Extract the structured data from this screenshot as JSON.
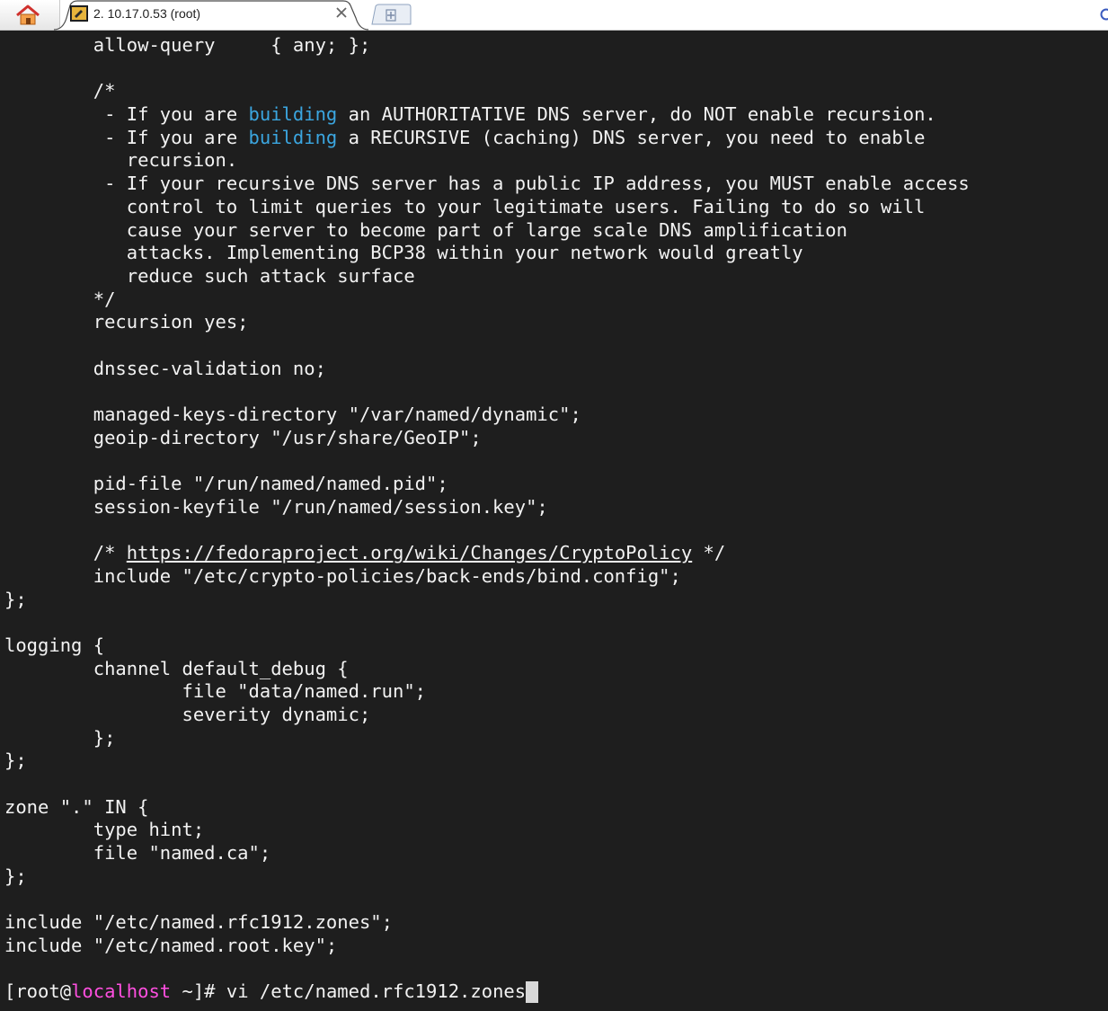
{
  "tab": {
    "title": "2. 10.17.0.53 (root)",
    "close_glyph": "×",
    "icon": "terminal-session-icon",
    "home_icon": "home-icon",
    "new_tab_icon": "plus-icon"
  },
  "colors": {
    "background": "#1e1e1e",
    "text": "#f2f2f2",
    "keyword": "#3ba6e0",
    "hostname": "#ff4fe0"
  },
  "terminal": {
    "lines": [
      [
        {
          "t": "        allow-query     { any; };"
        }
      ],
      [
        {
          "t": ""
        }
      ],
      [
        {
          "t": "        /*"
        }
      ],
      [
        {
          "t": "         - If you are "
        },
        {
          "t": "building",
          "c": "kw"
        },
        {
          "t": " an AUTHORITATIVE DNS server, do NOT enable recursion."
        }
      ],
      [
        {
          "t": "         - If you are "
        },
        {
          "t": "building",
          "c": "kw"
        },
        {
          "t": " a RECURSIVE (caching) DNS server, you need to enable"
        }
      ],
      [
        {
          "t": "           recursion."
        }
      ],
      [
        {
          "t": "         - If your recursive DNS server has a public IP address, you MUST enable access"
        }
      ],
      [
        {
          "t": "           control to limit queries to your legitimate users. Failing to do so will"
        }
      ],
      [
        {
          "t": "           cause your server to become part of large scale DNS amplification"
        }
      ],
      [
        {
          "t": "           attacks. Implementing BCP38 within your network would greatly"
        }
      ],
      [
        {
          "t": "           reduce such attack surface"
        }
      ],
      [
        {
          "t": "        */"
        }
      ],
      [
        {
          "t": "        recursion yes;"
        }
      ],
      [
        {
          "t": ""
        }
      ],
      [
        {
          "t": "        dnssec-validation no;"
        }
      ],
      [
        {
          "t": ""
        }
      ],
      [
        {
          "t": "        managed-keys-directory \"/var/named/dynamic\";"
        }
      ],
      [
        {
          "t": "        geoip-directory \"/usr/share/GeoIP\";"
        }
      ],
      [
        {
          "t": ""
        }
      ],
      [
        {
          "t": "        pid-file \"/run/named/named.pid\";"
        }
      ],
      [
        {
          "t": "        session-keyfile \"/run/named/session.key\";"
        }
      ],
      [
        {
          "t": ""
        }
      ],
      [
        {
          "t": "        /* "
        },
        {
          "t": "https://fedoraproject.org/wiki/Changes/CryptoPolicy",
          "c": "link"
        },
        {
          "t": " */"
        }
      ],
      [
        {
          "t": "        include \"/etc/crypto-policies/back-ends/bind.config\";"
        }
      ],
      [
        {
          "t": "};"
        }
      ],
      [
        {
          "t": ""
        }
      ],
      [
        {
          "t": "logging {"
        }
      ],
      [
        {
          "t": "        channel default_debug {"
        }
      ],
      [
        {
          "t": "                file \"data/named.run\";"
        }
      ],
      [
        {
          "t": "                severity dynamic;"
        }
      ],
      [
        {
          "t": "        };"
        }
      ],
      [
        {
          "t": "};"
        }
      ],
      [
        {
          "t": ""
        }
      ],
      [
        {
          "t": "zone \".\" IN {"
        }
      ],
      [
        {
          "t": "        type hint;"
        }
      ],
      [
        {
          "t": "        file \"named.ca\";"
        }
      ],
      [
        {
          "t": "};"
        }
      ],
      [
        {
          "t": ""
        }
      ],
      [
        {
          "t": "include \"/etc/named.rfc1912.zones\";"
        }
      ],
      [
        {
          "t": "include \"/etc/named.root.key\";"
        }
      ],
      [
        {
          "t": ""
        }
      ],
      [
        {
          "t": "[root@"
        },
        {
          "t": "localhost",
          "c": "host"
        },
        {
          "t": " ~]# vi /etc/named.rfc1912.zones"
        },
        {
          "cursor": true
        }
      ]
    ]
  }
}
